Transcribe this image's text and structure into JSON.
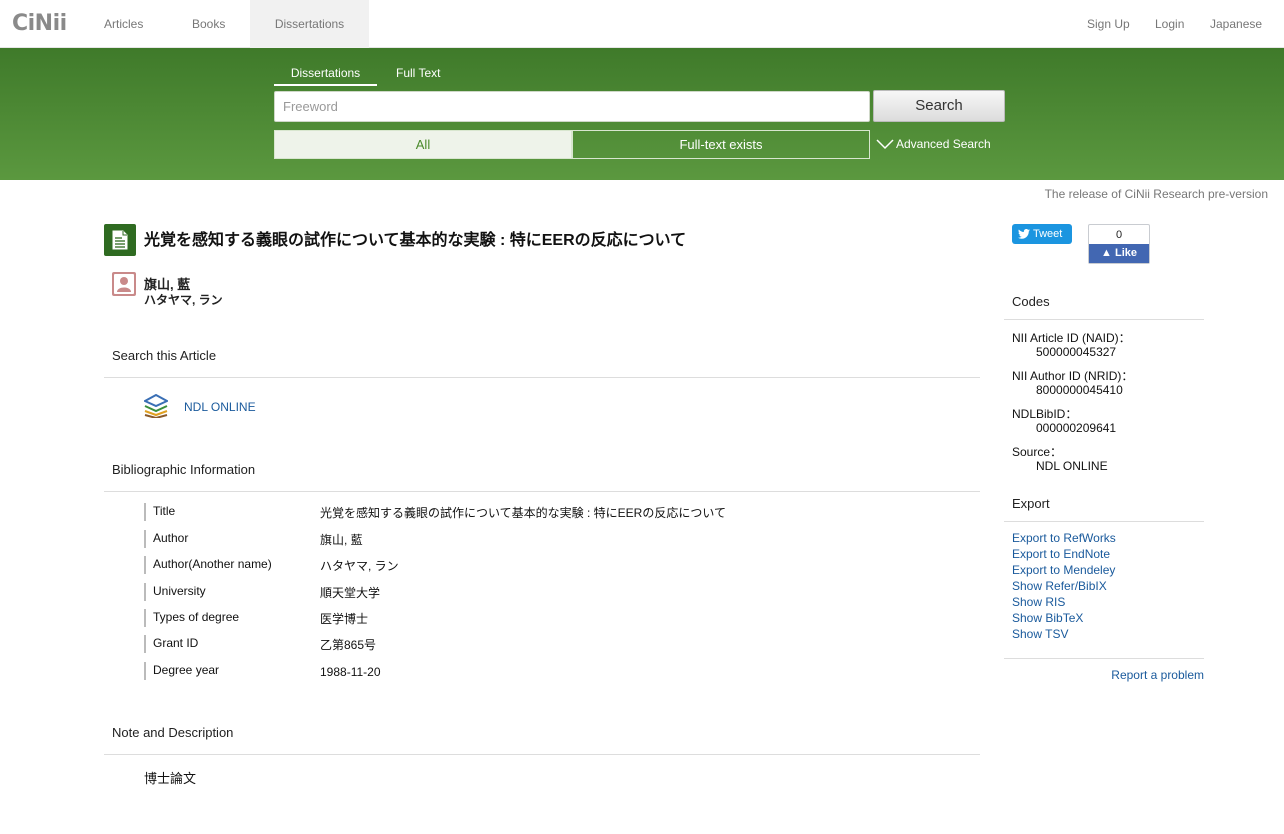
{
  "nav": {
    "logo": "CiNii",
    "articles": "Articles",
    "books": "Books",
    "dissertations": "Dissertations",
    "signup": "Sign Up",
    "login": "Login",
    "language": "Japanese"
  },
  "search": {
    "tab_dissertations": "Dissertations",
    "tab_fulltext": "Full Text",
    "placeholder": "Freeword",
    "button": "Search",
    "filter_all": "All",
    "filter_fulltext": "Full-text exists",
    "advanced": "Advanced Search"
  },
  "release_notice": "The release of CiNii Research pre-version",
  "article": {
    "title": "光覚を感知する義眼の試作について基本的な実験 : 特にEERの反応について",
    "author_name": "旗山, 藍",
    "author_kana": "ハタヤマ, ラン"
  },
  "sections": {
    "search_article": "Search this Article",
    "bibliographic": "Bibliographic Information",
    "note": "Note and Description"
  },
  "ndl_link": "NDL ONLINE",
  "biblio": [
    {
      "label": "Title",
      "value": "光覚を感知する義眼の試作について基本的な実験 : 特にEERの反応について"
    },
    {
      "label": "Author",
      "value": "旗山, 藍"
    },
    {
      "label": "Author(Another name)",
      "value": "ハタヤマ, ラン"
    },
    {
      "label": "University",
      "value": "順天堂大学"
    },
    {
      "label": "Types of degree",
      "value": "医学博士"
    },
    {
      "label": "Grant ID",
      "value": "乙第865号"
    },
    {
      "label": "Degree year",
      "value": "1988-11-20"
    }
  ],
  "note_text": "博士論文",
  "social": {
    "tweet": "Tweet",
    "fb_count": "0",
    "fb_like": "Like"
  },
  "codes": {
    "heading": "Codes",
    "items": [
      {
        "label": "NII Article ID (NAID)：",
        "value": "500000045327"
      },
      {
        "label": "NII Author ID (NRID)：",
        "value": "8000000045410"
      },
      {
        "label": "NDLBibID：",
        "value": "000000209641"
      },
      {
        "label": "Source：",
        "value": "NDL ONLINE"
      }
    ]
  },
  "export": {
    "heading": "Export",
    "links": [
      "Export to RefWorks",
      "Export to EndNote",
      "Export to Mendeley",
      "Show Refer/BibIX",
      "Show RIS",
      "Show BibTeX",
      "Show TSV"
    ]
  },
  "report": "Report a problem"
}
